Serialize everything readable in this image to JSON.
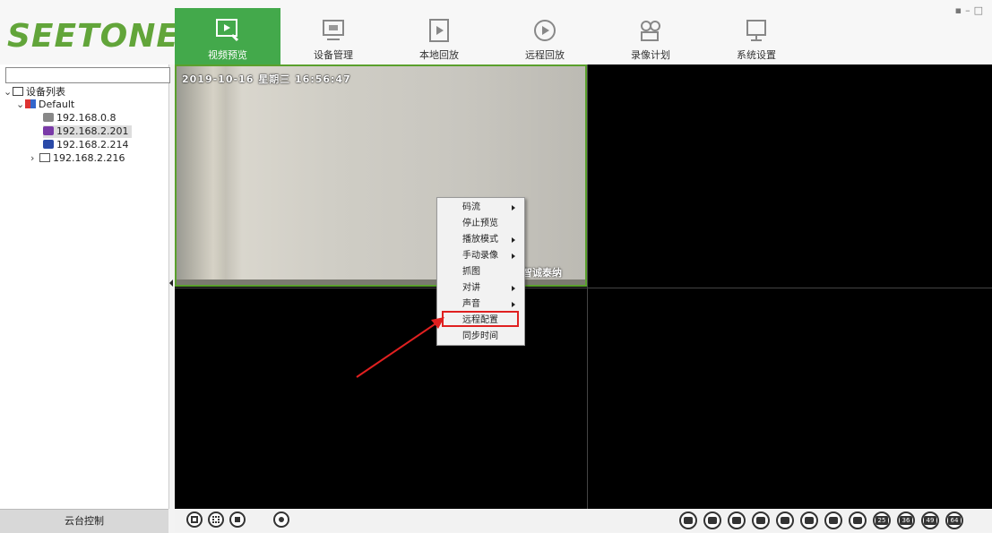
{
  "app": {
    "logo": "SEETONE"
  },
  "nav": [
    {
      "label": "视频预览",
      "icon": "video-preview-icon",
      "active": true
    },
    {
      "label": "设备管理",
      "icon": "device-manage-icon"
    },
    {
      "label": "本地回放",
      "icon": "local-playback-icon"
    },
    {
      "label": "远程回放",
      "icon": "remote-playback-icon"
    },
    {
      "label": "录像计划",
      "icon": "record-plan-icon"
    },
    {
      "label": "系统设置",
      "icon": "system-settings-icon"
    }
  ],
  "window_controls": {
    "min": "–",
    "max": "□"
  },
  "sidebar": {
    "search_placeholder": "",
    "root": "设备列表",
    "group": "Default",
    "devices": [
      "192.168.0.8",
      "192.168.2.201",
      "192.168.2.214",
      "192.168.2.216"
    ],
    "ptz_label": "云台控制"
  },
  "video": {
    "osd_time": "2019-10-16 星期三 16:56:47",
    "osd_name": "智诚泰纳"
  },
  "context_menu": {
    "items": [
      "码流",
      "停止预览",
      "播放模式",
      "手动录像",
      "抓图",
      "对讲",
      "声音",
      "远程配置",
      "同步时间"
    ],
    "highlighted": "远程配置"
  },
  "layout_buttons": {
    "labels": [
      "25",
      "36",
      "49",
      "64"
    ]
  },
  "colors": {
    "accent": "#43a94b",
    "logo": "#62a53a",
    "highlight": "#e02020",
    "arrow": "#e02020"
  }
}
